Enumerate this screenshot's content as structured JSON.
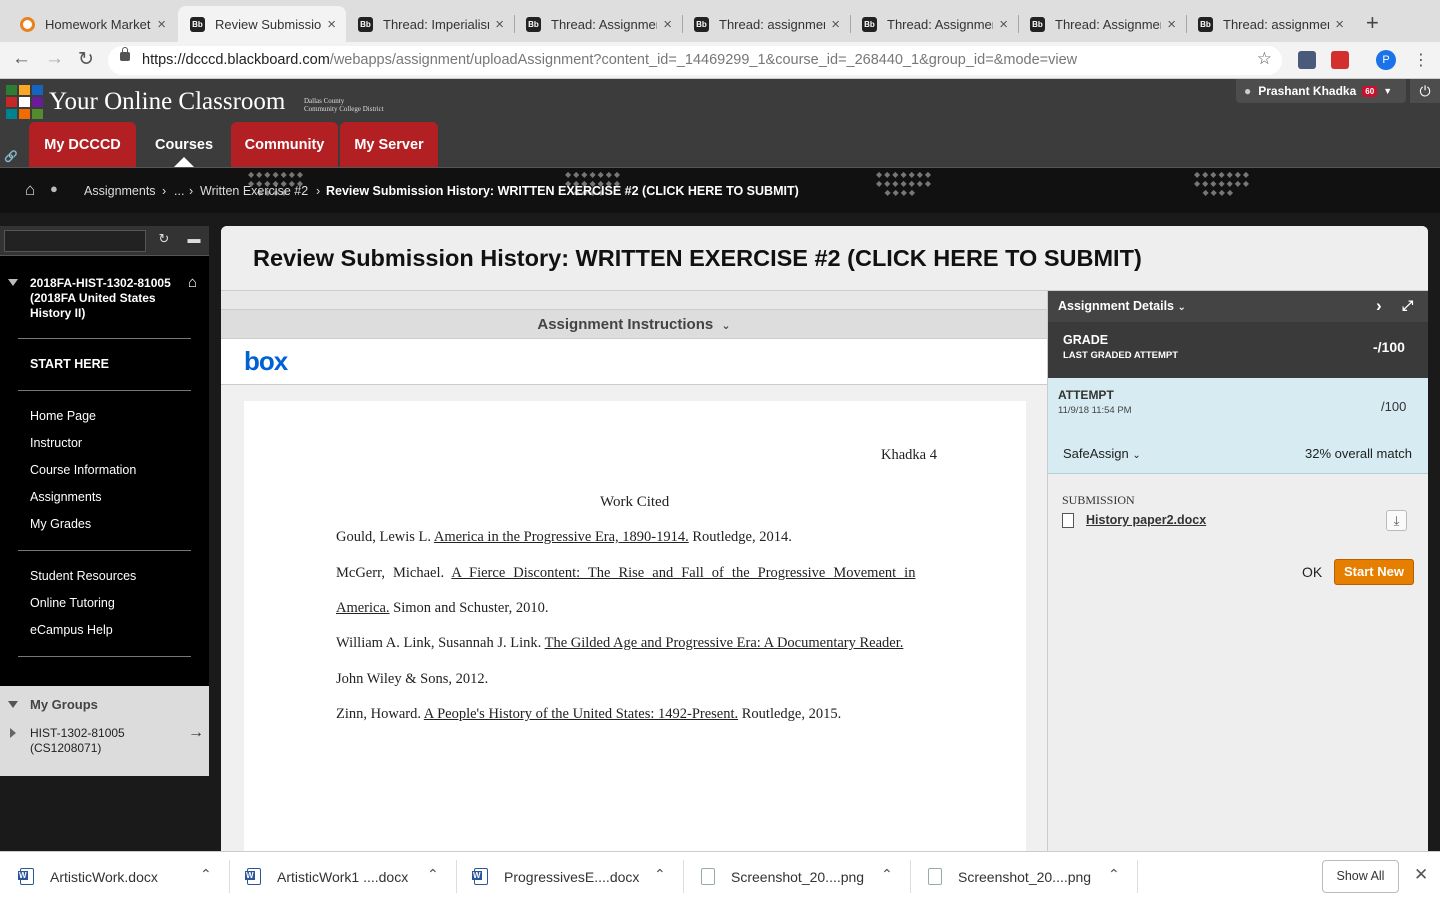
{
  "browser": {
    "tabs": [
      {
        "title": "Homework Market",
        "favicon": "homework-market-favicon"
      },
      {
        "title": "Review Submission History",
        "favicon": "blackboard-favicon"
      },
      {
        "title": "Thread: Imperialism",
        "favicon": "blackboard-favicon"
      },
      {
        "title": "Thread: Assignment",
        "favicon": "blackboard-favicon"
      },
      {
        "title": "Thread: assignment",
        "favicon": "blackboard-favicon"
      },
      {
        "title": "Thread: Assignment",
        "favicon": "blackboard-favicon"
      },
      {
        "title": "Thread: Assignment",
        "favicon": "blackboard-favicon"
      },
      {
        "title": "Thread: assignment",
        "favicon": "blackboard-favicon"
      }
    ],
    "url_domain": "https://dcccd.blackboard.com",
    "url_path": "/webapps/assignment/uploadAssignment?content_id=_14469299_1&course_id=_268440_1&group_id=&mode=view",
    "profile_initial": "P"
  },
  "header": {
    "brand_title": "Your Online Classroom",
    "brand_subtitle_1": "Dallas County",
    "brand_subtitle_2": "Community College District",
    "user_name": "Prashant Khadka",
    "notification_count": "60",
    "nav_tabs": [
      "My DCCCD",
      "Courses",
      "Community",
      "My Server"
    ]
  },
  "breadcrumb": {
    "items": [
      "Assignments",
      "...",
      "Written Exercise #2"
    ],
    "current": "Review Submission History: WRITTEN EXERCISE #2 (CLICK HERE TO SUBMIT)"
  },
  "course_menu": {
    "course_title": "2018FA-HIST-1302-81005 (2018FA United States History II)",
    "section1": [
      "START HERE"
    ],
    "section2": [
      "Home Page",
      "Instructor",
      "Course Information",
      "Assignments",
      "My Grades"
    ],
    "section3": [
      "Student Resources",
      "Online Tutoring",
      "eCampus Help"
    ],
    "groups_heading": "My Groups",
    "group_item_1": "HIST-1302-81005",
    "group_item_2": "(CS1208071)"
  },
  "page": {
    "title": "Review Submission History: WRITTEN EXERCISE #2 (CLICK HERE TO SUBMIT)",
    "instructions_label": "Assignment Instructions",
    "viewer_brand": "box"
  },
  "document": {
    "header_right": "Khadka 4",
    "heading": "Work Cited",
    "citations": [
      {
        "pre": "Gould, Lewis L. ",
        "title": "America in the Progressive Era, 1890-1914.",
        "post": " Routledge, 2014."
      },
      {
        "pre": "McGerr, Michael. ",
        "title": "A Fierce Discontent: The Rise and Fall of the Progressive Movement in",
        "post": ""
      },
      {
        "pre": "",
        "title": "America.",
        "post": " Simon and Schuster, 2010."
      },
      {
        "pre": "William A. Link, Susannah J. Link. ",
        "title": "The Gilded Age and Progressive Era: A Documentary Reader.",
        "post": ""
      },
      {
        "pre": "John Wiley & Sons, 2012.",
        "title": "",
        "post": ""
      },
      {
        "pre": "Zinn, Howard. ",
        "title": "A People's History of the United States: 1492-Present.",
        "post": " Routledge, 2015."
      }
    ]
  },
  "details": {
    "heading": "Assignment Details",
    "grade_label": "GRADE",
    "grade_sub": "LAST GRADED ATTEMPT",
    "grade_value": "-/100",
    "attempt_label": "ATTEMPT",
    "attempt_date": "11/9/18 11:54 PM",
    "attempt_value": "/100",
    "safeassign_label": "SafeAssign",
    "safeassign_match": "32% overall match",
    "submission_label": "SUBMISSION",
    "file_name": "History paper2.docx",
    "ok_label": "OK",
    "start_new_label": "Start New"
  },
  "downloads": {
    "items": [
      {
        "name": "ArtisticWork.docx",
        "type": "word"
      },
      {
        "name": "ArtisticWork1 ....docx",
        "type": "word"
      },
      {
        "name": "ProgressivesE....docx",
        "type": "word"
      },
      {
        "name": "Screenshot_20....png",
        "type": "image"
      },
      {
        "name": "Screenshot_20....png",
        "type": "image"
      }
    ],
    "show_all": "Show All"
  },
  "colors": {
    "nav_red": "#b32024",
    "start_new_orange": "#e67e00",
    "attempt_bg": "#d6ecf2",
    "box_blue": "#0061d5"
  }
}
